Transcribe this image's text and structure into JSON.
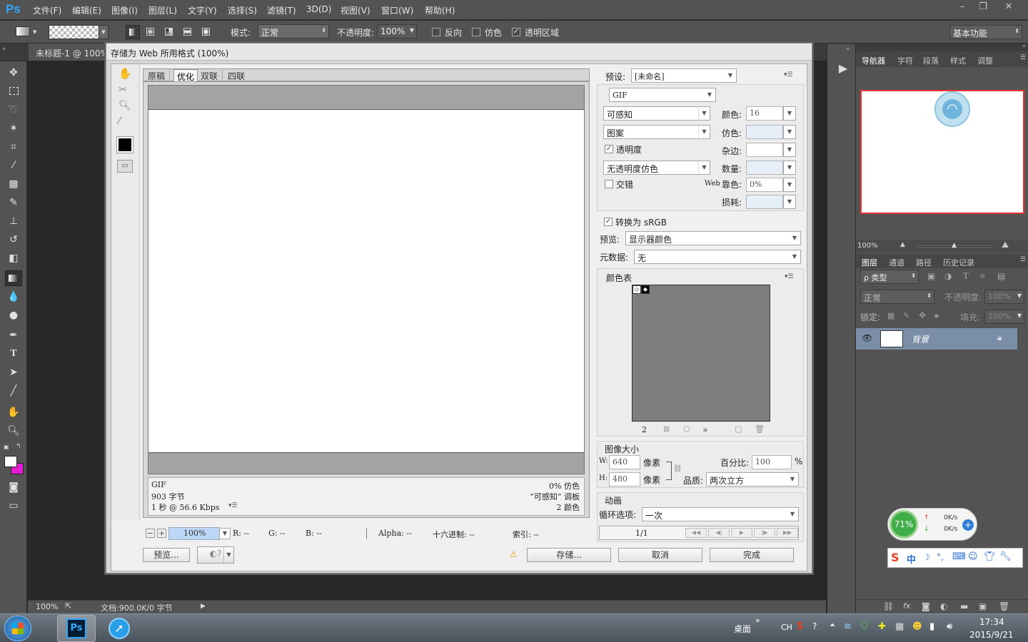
{
  "app": {
    "logo": "Ps"
  },
  "menubar": {
    "items": [
      "文件(F)",
      "编辑(E)",
      "图像(I)",
      "图层(L)",
      "文字(Y)",
      "选择(S)",
      "滤镜(T)",
      "3D(D)",
      "视图(V)",
      "窗口(W)",
      "帮助(H)"
    ],
    "window_buttons": [
      "–",
      "❐",
      "✕"
    ]
  },
  "options": {
    "mode_label": "模式:",
    "mode_value": "正常",
    "opacity_label": "不透明度:",
    "opacity_value": "100%",
    "reverse_label": "反向",
    "dither_label": "仿色",
    "transparency_label": "透明区域",
    "workspace": "基本功能"
  },
  "doc_tab": {
    "title": "未标题-1 @ 100%"
  },
  "status": {
    "zoom": "100%",
    "doc_info": "文档:900.0K/0 字节"
  },
  "right_panel": {
    "nav_tabs": [
      "导航器",
      "字符",
      "段落",
      "样式",
      "调整"
    ],
    "nav_zoom": "100%",
    "layer_tabs": [
      "图层",
      "通道",
      "路径",
      "历史记录"
    ],
    "kind_label": "ρ 类型",
    "blend_mode": "正常",
    "opacity_label": "不透明度:",
    "opacity_value": "100%",
    "lock_label": "锁定:",
    "fill_label": "填充:",
    "fill_value": "100%",
    "layer_name": "背景"
  },
  "net_widget": {
    "percent": "71%",
    "up": "0K/s",
    "down": "0K/s"
  },
  "ime_toolbar": {
    "label": "中"
  },
  "dialog": {
    "title": "存储为 Web 所用格式 (100%)",
    "view_tabs": [
      "原稿",
      "优化",
      "双联",
      "四联"
    ],
    "info": {
      "format": "GIF",
      "size": "903 字节",
      "time": "1 秒 @ 56.6 Kbps",
      "dither": "0% 仿色",
      "palette": "“可感知” 调板",
      "colors": "2 颜色"
    },
    "zoom": "100%",
    "readouts": {
      "r": "R: --",
      "g": "G: --",
      "b": "B: --",
      "alpha": "Alpha: --",
      "hex": "十六进制: --",
      "index": "索引: --"
    },
    "preview_button": "预览...",
    "save_button": "存储...",
    "cancel_button": "取消",
    "done_button": "完成",
    "preset_label": "预设:",
    "preset_value": "[未命名]",
    "format": "GIF",
    "reduction": "可感知",
    "dither_algo": "图案",
    "transparency_label": "透明度",
    "transparency_dither": "无透明度仿色",
    "interlaced_label": "交错",
    "colors_label": "颜色:",
    "colors_value": "16",
    "dither_label": "仿色:",
    "matte_label": "杂边:",
    "amount_label": "数量:",
    "websnap_label_web": "Web",
    "websnap_label": "靠色:",
    "websnap_value": "0%",
    "lossy_label": "损耗:",
    "srgb_label": "转换为 sRGB",
    "preview_label": "预览:",
    "preview_value": "显示器颜色",
    "metadata_label": "元数据:",
    "metadata_value": "无",
    "color_table_label": "颜色表",
    "color_count": "2",
    "image_size_label": "图像大小",
    "w_label": "W:",
    "w_value": "640",
    "h_label": "H:",
    "h_value": "480",
    "px_label": "像素",
    "percent_label": "百分比:",
    "percent_value": "100",
    "percent_unit": "%",
    "quality_label": "品质:",
    "quality_value": "两次立方",
    "animation_label": "动画",
    "loop_label": "循环选项:",
    "loop_value": "一次",
    "frame": "1/1"
  },
  "taskbar": {
    "desktop": "桌面",
    "lang": "CH",
    "time": "17:34",
    "date": "2015/9/21"
  }
}
